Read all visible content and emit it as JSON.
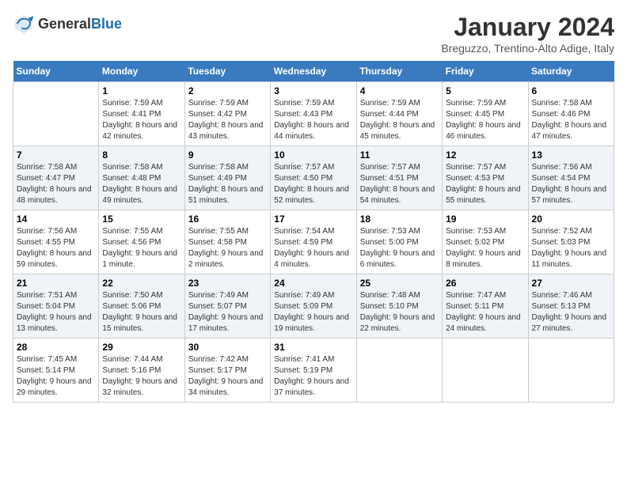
{
  "header": {
    "logo_general": "General",
    "logo_blue": "Blue",
    "month_title": "January 2024",
    "location": "Breguzzo, Trentino-Alto Adige, Italy"
  },
  "days_of_week": [
    "Sunday",
    "Monday",
    "Tuesday",
    "Wednesday",
    "Thursday",
    "Friday",
    "Saturday"
  ],
  "weeks": [
    [
      {
        "day": "",
        "sunrise": "",
        "sunset": "",
        "daylight": ""
      },
      {
        "day": "1",
        "sunrise": "Sunrise: 7:59 AM",
        "sunset": "Sunset: 4:41 PM",
        "daylight": "Daylight: 8 hours and 42 minutes."
      },
      {
        "day": "2",
        "sunrise": "Sunrise: 7:59 AM",
        "sunset": "Sunset: 4:42 PM",
        "daylight": "Daylight: 8 hours and 43 minutes."
      },
      {
        "day": "3",
        "sunrise": "Sunrise: 7:59 AM",
        "sunset": "Sunset: 4:43 PM",
        "daylight": "Daylight: 8 hours and 44 minutes."
      },
      {
        "day": "4",
        "sunrise": "Sunrise: 7:59 AM",
        "sunset": "Sunset: 4:44 PM",
        "daylight": "Daylight: 8 hours and 45 minutes."
      },
      {
        "day": "5",
        "sunrise": "Sunrise: 7:59 AM",
        "sunset": "Sunset: 4:45 PM",
        "daylight": "Daylight: 8 hours and 46 minutes."
      },
      {
        "day": "6",
        "sunrise": "Sunrise: 7:58 AM",
        "sunset": "Sunset: 4:46 PM",
        "daylight": "Daylight: 8 hours and 47 minutes."
      }
    ],
    [
      {
        "day": "7",
        "sunrise": "Sunrise: 7:58 AM",
        "sunset": "Sunset: 4:47 PM",
        "daylight": "Daylight: 8 hours and 48 minutes."
      },
      {
        "day": "8",
        "sunrise": "Sunrise: 7:58 AM",
        "sunset": "Sunset: 4:48 PM",
        "daylight": "Daylight: 8 hours and 49 minutes."
      },
      {
        "day": "9",
        "sunrise": "Sunrise: 7:58 AM",
        "sunset": "Sunset: 4:49 PM",
        "daylight": "Daylight: 8 hours and 51 minutes."
      },
      {
        "day": "10",
        "sunrise": "Sunrise: 7:57 AM",
        "sunset": "Sunset: 4:50 PM",
        "daylight": "Daylight: 8 hours and 52 minutes."
      },
      {
        "day": "11",
        "sunrise": "Sunrise: 7:57 AM",
        "sunset": "Sunset: 4:51 PM",
        "daylight": "Daylight: 8 hours and 54 minutes."
      },
      {
        "day": "12",
        "sunrise": "Sunrise: 7:57 AM",
        "sunset": "Sunset: 4:53 PM",
        "daylight": "Daylight: 8 hours and 55 minutes."
      },
      {
        "day": "13",
        "sunrise": "Sunrise: 7:56 AM",
        "sunset": "Sunset: 4:54 PM",
        "daylight": "Daylight: 8 hours and 57 minutes."
      }
    ],
    [
      {
        "day": "14",
        "sunrise": "Sunrise: 7:56 AM",
        "sunset": "Sunset: 4:55 PM",
        "daylight": "Daylight: 8 hours and 59 minutes."
      },
      {
        "day": "15",
        "sunrise": "Sunrise: 7:55 AM",
        "sunset": "Sunset: 4:56 PM",
        "daylight": "Daylight: 9 hours and 1 minute."
      },
      {
        "day": "16",
        "sunrise": "Sunrise: 7:55 AM",
        "sunset": "Sunset: 4:58 PM",
        "daylight": "Daylight: 9 hours and 2 minutes."
      },
      {
        "day": "17",
        "sunrise": "Sunrise: 7:54 AM",
        "sunset": "Sunset: 4:59 PM",
        "daylight": "Daylight: 9 hours and 4 minutes."
      },
      {
        "day": "18",
        "sunrise": "Sunrise: 7:53 AM",
        "sunset": "Sunset: 5:00 PM",
        "daylight": "Daylight: 9 hours and 6 minutes."
      },
      {
        "day": "19",
        "sunrise": "Sunrise: 7:53 AM",
        "sunset": "Sunset: 5:02 PM",
        "daylight": "Daylight: 9 hours and 8 minutes."
      },
      {
        "day": "20",
        "sunrise": "Sunrise: 7:52 AM",
        "sunset": "Sunset: 5:03 PM",
        "daylight": "Daylight: 9 hours and 11 minutes."
      }
    ],
    [
      {
        "day": "21",
        "sunrise": "Sunrise: 7:51 AM",
        "sunset": "Sunset: 5:04 PM",
        "daylight": "Daylight: 9 hours and 13 minutes."
      },
      {
        "day": "22",
        "sunrise": "Sunrise: 7:50 AM",
        "sunset": "Sunset: 5:06 PM",
        "daylight": "Daylight: 9 hours and 15 minutes."
      },
      {
        "day": "23",
        "sunrise": "Sunrise: 7:49 AM",
        "sunset": "Sunset: 5:07 PM",
        "daylight": "Daylight: 9 hours and 17 minutes."
      },
      {
        "day": "24",
        "sunrise": "Sunrise: 7:49 AM",
        "sunset": "Sunset: 5:09 PM",
        "daylight": "Daylight: 9 hours and 19 minutes."
      },
      {
        "day": "25",
        "sunrise": "Sunrise: 7:48 AM",
        "sunset": "Sunset: 5:10 PM",
        "daylight": "Daylight: 9 hours and 22 minutes."
      },
      {
        "day": "26",
        "sunrise": "Sunrise: 7:47 AM",
        "sunset": "Sunset: 5:11 PM",
        "daylight": "Daylight: 9 hours and 24 minutes."
      },
      {
        "day": "27",
        "sunrise": "Sunrise: 7:46 AM",
        "sunset": "Sunset: 5:13 PM",
        "daylight": "Daylight: 9 hours and 27 minutes."
      }
    ],
    [
      {
        "day": "28",
        "sunrise": "Sunrise: 7:45 AM",
        "sunset": "Sunset: 5:14 PM",
        "daylight": "Daylight: 9 hours and 29 minutes."
      },
      {
        "day": "29",
        "sunrise": "Sunrise: 7:44 AM",
        "sunset": "Sunset: 5:16 PM",
        "daylight": "Daylight: 9 hours and 32 minutes."
      },
      {
        "day": "30",
        "sunrise": "Sunrise: 7:42 AM",
        "sunset": "Sunset: 5:17 PM",
        "daylight": "Daylight: 9 hours and 34 minutes."
      },
      {
        "day": "31",
        "sunrise": "Sunrise: 7:41 AM",
        "sunset": "Sunset: 5:19 PM",
        "daylight": "Daylight: 9 hours and 37 minutes."
      },
      {
        "day": "",
        "sunrise": "",
        "sunset": "",
        "daylight": ""
      },
      {
        "day": "",
        "sunrise": "",
        "sunset": "",
        "daylight": ""
      },
      {
        "day": "",
        "sunrise": "",
        "sunset": "",
        "daylight": ""
      }
    ]
  ]
}
